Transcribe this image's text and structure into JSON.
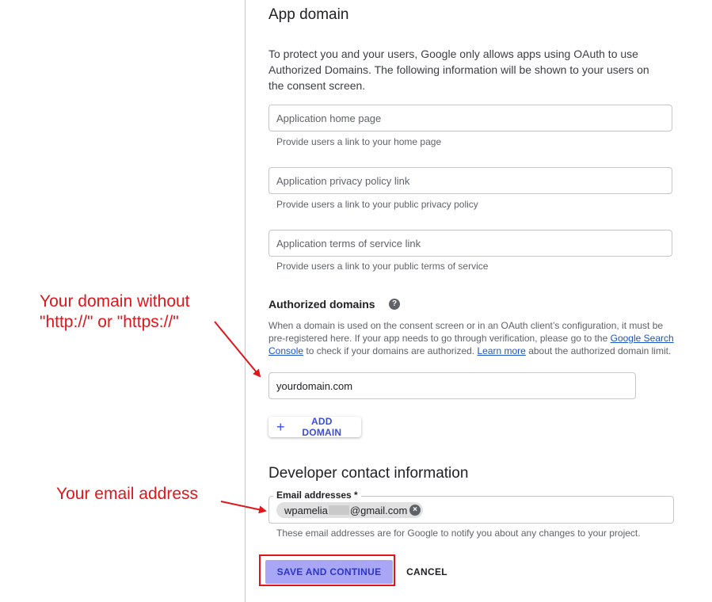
{
  "app_domain": {
    "title": "App domain",
    "intro": "To protect you and your users, Google only allows apps using OAuth to use Authorized Domains. The following information will be shown to your users on the consent screen.",
    "home_page": {
      "placeholder": "Application home page",
      "hint": "Provide users a link to your home page"
    },
    "privacy_policy": {
      "placeholder": "Application privacy policy link",
      "hint": "Provide users a link to your public privacy policy"
    },
    "terms_of_service": {
      "placeholder": "Application terms of service link",
      "hint": "Provide users a link to your public terms of service"
    }
  },
  "authorized_domains": {
    "title": "Authorized domains",
    "help_icon": "help-circle-icon",
    "desc_part1": "When a domain is used on the consent screen or in an OAuth client’s configuration, it must be pre-registered here. If your app needs to go through verification, please go to the ",
    "desc_link1": "Google Search Console",
    "desc_part2": " to check if your domains are authorized. ",
    "desc_link2": "Learn more",
    "desc_part3": " about the authorized domain limit.",
    "domain_value": "yourdomain.com",
    "add_button_icon": "plus-icon",
    "add_button_label": "ADD DOMAIN"
  },
  "developer_contact": {
    "title": "Developer contact information",
    "email_label": "Email addresses *",
    "email_chip_prefix": "wpamelia",
    "email_chip_suffix": "@gmail.com",
    "hint": "These email addresses are for Google to notify you about any changes to your project."
  },
  "actions": {
    "save_label": "SAVE AND CONTINUE",
    "cancel_label": "CANCEL"
  },
  "annotations": {
    "domain_note_line1": "Your domain without",
    "domain_note_line2": "\"http://\" or \"https://\"",
    "email_note": "Your email address",
    "color": "#e0161b"
  }
}
